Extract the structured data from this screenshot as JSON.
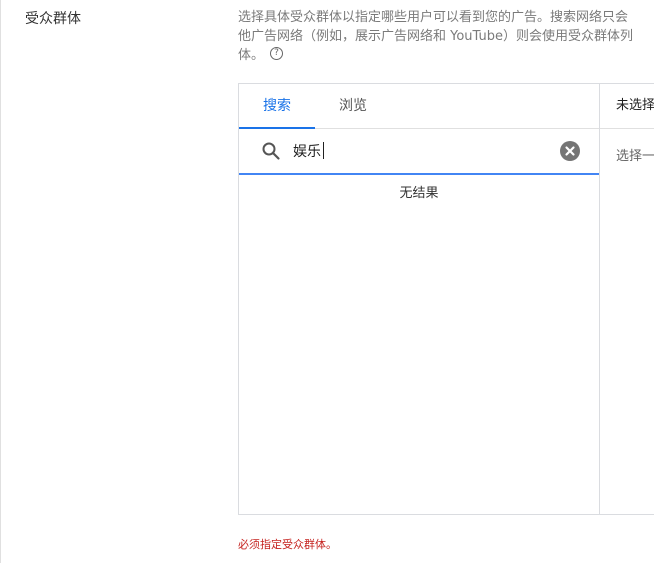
{
  "section": {
    "label": "受众群体"
  },
  "description": {
    "line1": "选择具体受众群体以指定哪些用户可以看到您的广告。搜索网络只会",
    "line2": "他广告网络（例如，展示广告网络和 YouTube）则会使用受众群体列",
    "line3": "体。",
    "help_glyph": "?"
  },
  "tabs": [
    {
      "label": "搜索",
      "active": true
    },
    {
      "label": "浏览",
      "active": false
    }
  ],
  "search": {
    "value": "娱乐",
    "placeholder": ""
  },
  "results": {
    "empty_text": "无结果"
  },
  "selected_panel": {
    "header": "未选择",
    "hint": "选择一"
  },
  "error": {
    "text": "必须指定受众群体。",
    "color": "#c5221f"
  },
  "colors": {
    "accent": "#1a73e8",
    "underline": "#4285f4"
  },
  "icons": {
    "search": "search-icon",
    "clear": "clear-icon",
    "help": "help-icon"
  }
}
